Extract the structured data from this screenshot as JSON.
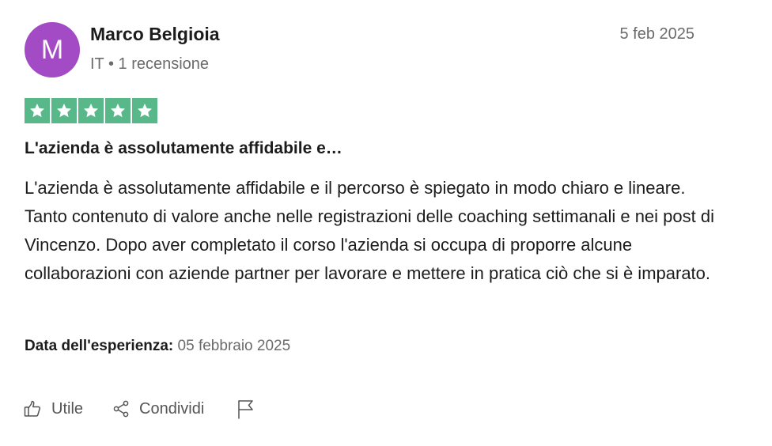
{
  "reviewer": {
    "initial": "M",
    "avatar_color": "#a24bc4",
    "name": "Marco Belgioia",
    "meta": "IT • 1 recensione"
  },
  "review": {
    "date": "5 feb 2025",
    "rating": 5,
    "rating_max": 5,
    "star_color": "#59b88a",
    "star_icon": "star-icon",
    "title": "L'azienda è assolutamente affidabile e…",
    "body": "L'azienda è assolutamente affidabile e il percorso è spiegato in modo chiaro e lineare. Tanto contenuto di valore anche nelle registrazioni delle coaching settimanali e nei post di Vincenzo. Dopo aver completato il corso l'azienda si occupa di proporre alcune collaborazioni con aziende partner per lavorare e mettere in pratica ciò che si è imparato.",
    "experience_label": "Data dell'esperienza:",
    "experience_date": "05 febbraio 2025"
  },
  "actions": {
    "useful_label": "Utile",
    "useful_icon": "thumbs-up-icon",
    "share_label": "Condividi",
    "share_icon": "share-icon",
    "report_icon": "flag-icon"
  }
}
